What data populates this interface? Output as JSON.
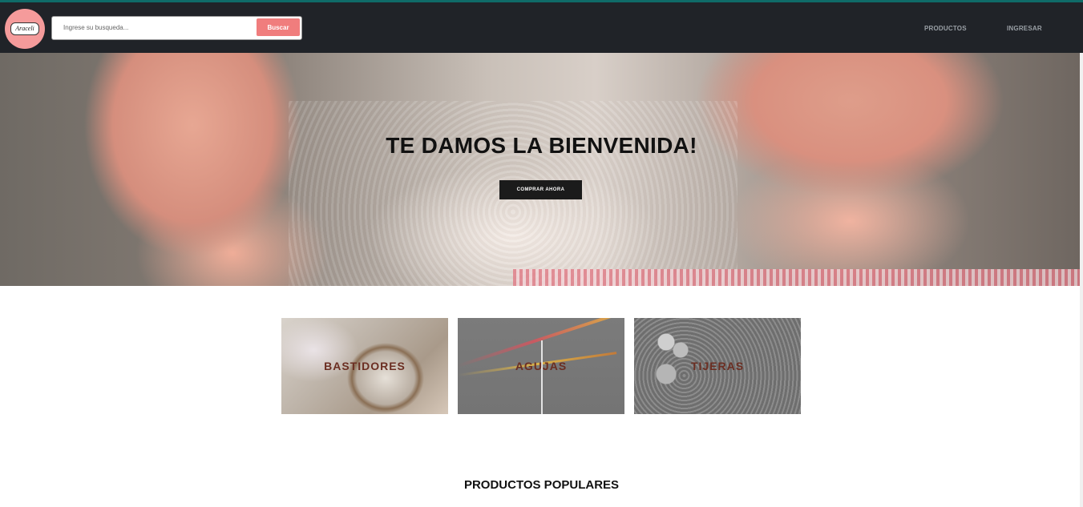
{
  "header": {
    "logo_text": "Araceli",
    "search": {
      "placeholder": "Ingrese su busqueda...",
      "value": ""
    },
    "search_button_label": "Buscar",
    "nav": [
      {
        "label": "PRODUCTOS"
      },
      {
        "label": "INGRESAR"
      }
    ]
  },
  "hero": {
    "title": "TE DAMOS LA BIENVENIDA!",
    "cta_label": "COMPRAR AHORA"
  },
  "categories": [
    {
      "label": "BASTIDORES"
    },
    {
      "label": "AGUJAS"
    },
    {
      "label": "TIJERAS"
    }
  ],
  "popular": {
    "title": "PRODUCTOS POPULARES"
  },
  "colors": {
    "header_bg": "#202328",
    "accent_pink": "#f07d7d",
    "logo_bg": "#f59b9b",
    "top_line": "#0f6b68",
    "category_label": "#6b2e22"
  }
}
